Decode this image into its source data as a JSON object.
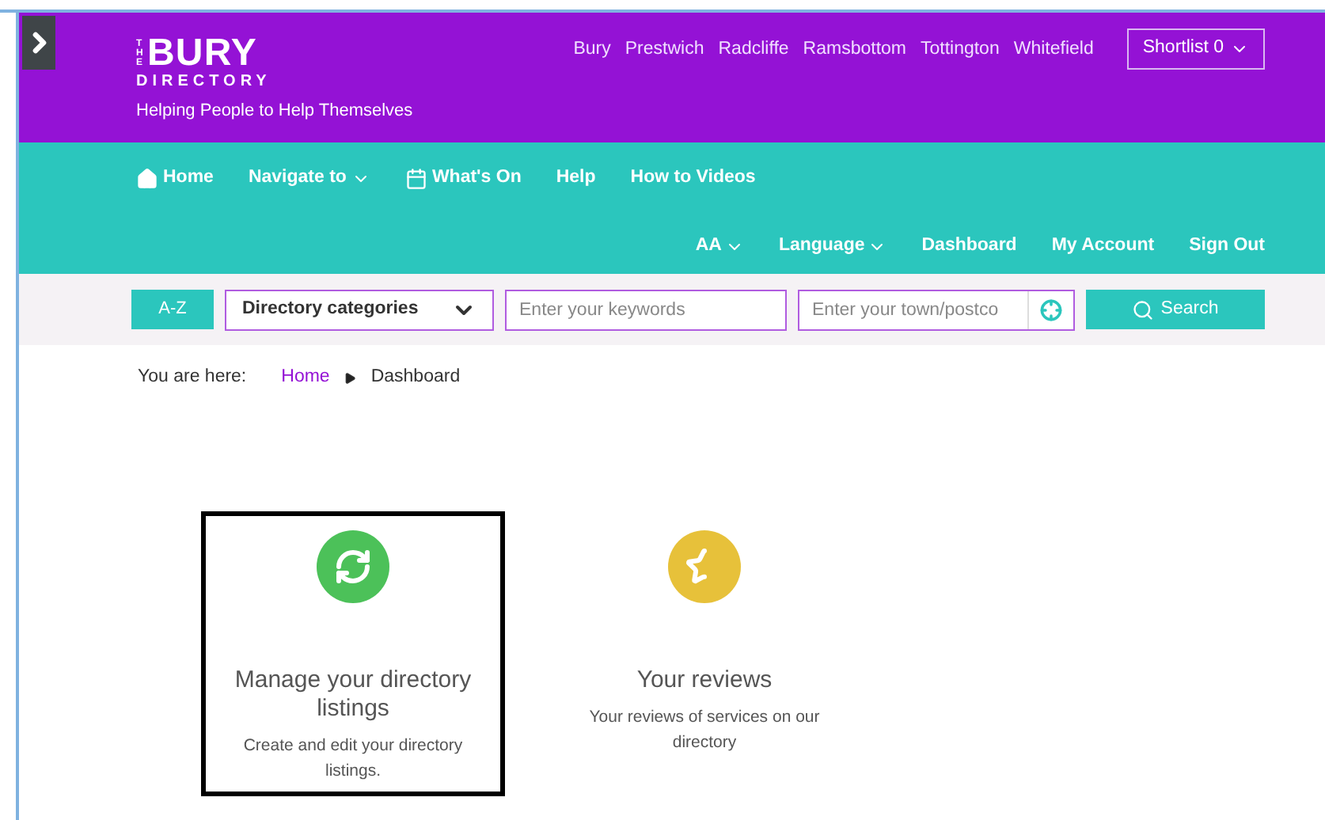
{
  "logo": {
    "prefix": "THE",
    "name": "BURY",
    "subtitle": "DIRECTORY",
    "tagline": "Helping People to Help Themselves"
  },
  "towns": [
    "Bury",
    "Prestwich",
    "Radcliffe",
    "Ramsbottom",
    "Tottington",
    "Whitefield"
  ],
  "shortlist": "Shortlist 0",
  "nav": [
    {
      "label": "Home",
      "kind": "home",
      "dropdown": false
    },
    {
      "label": "Navigate to",
      "kind": "plain",
      "dropdown": true
    },
    {
      "label": "What's On",
      "kind": "calendar",
      "dropdown": false
    },
    {
      "label": "Help",
      "kind": "plain",
      "dropdown": false
    },
    {
      "label": "How to Videos",
      "kind": "plain",
      "dropdown": false
    }
  ],
  "account_nav": [
    {
      "label": "AA",
      "dropdown": true
    },
    {
      "label": "Language",
      "dropdown": true
    },
    {
      "label": "Dashboard",
      "dropdown": false
    },
    {
      "label": "My Account",
      "dropdown": false
    },
    {
      "label": "Sign Out",
      "dropdown": false
    }
  ],
  "search": {
    "az": "A-Z",
    "category": "Directory categories",
    "keywords_placeholder": "Enter your keywords",
    "location_placeholder": "Enter your town/postco",
    "button": "Search"
  },
  "breadcrumb": {
    "prefix": "You are here:",
    "items": [
      "Home",
      "Dashboard"
    ]
  },
  "cards": [
    {
      "title": "Manage your directory listings",
      "description": "Create and edit your directory listings.",
      "kind": "refresh",
      "color": "#4cc159",
      "highlighted": true
    },
    {
      "title": "Your reviews",
      "description": "Your reviews of services on our directory",
      "kind": "star",
      "color": "#e7c13a",
      "highlighted": false
    }
  ]
}
